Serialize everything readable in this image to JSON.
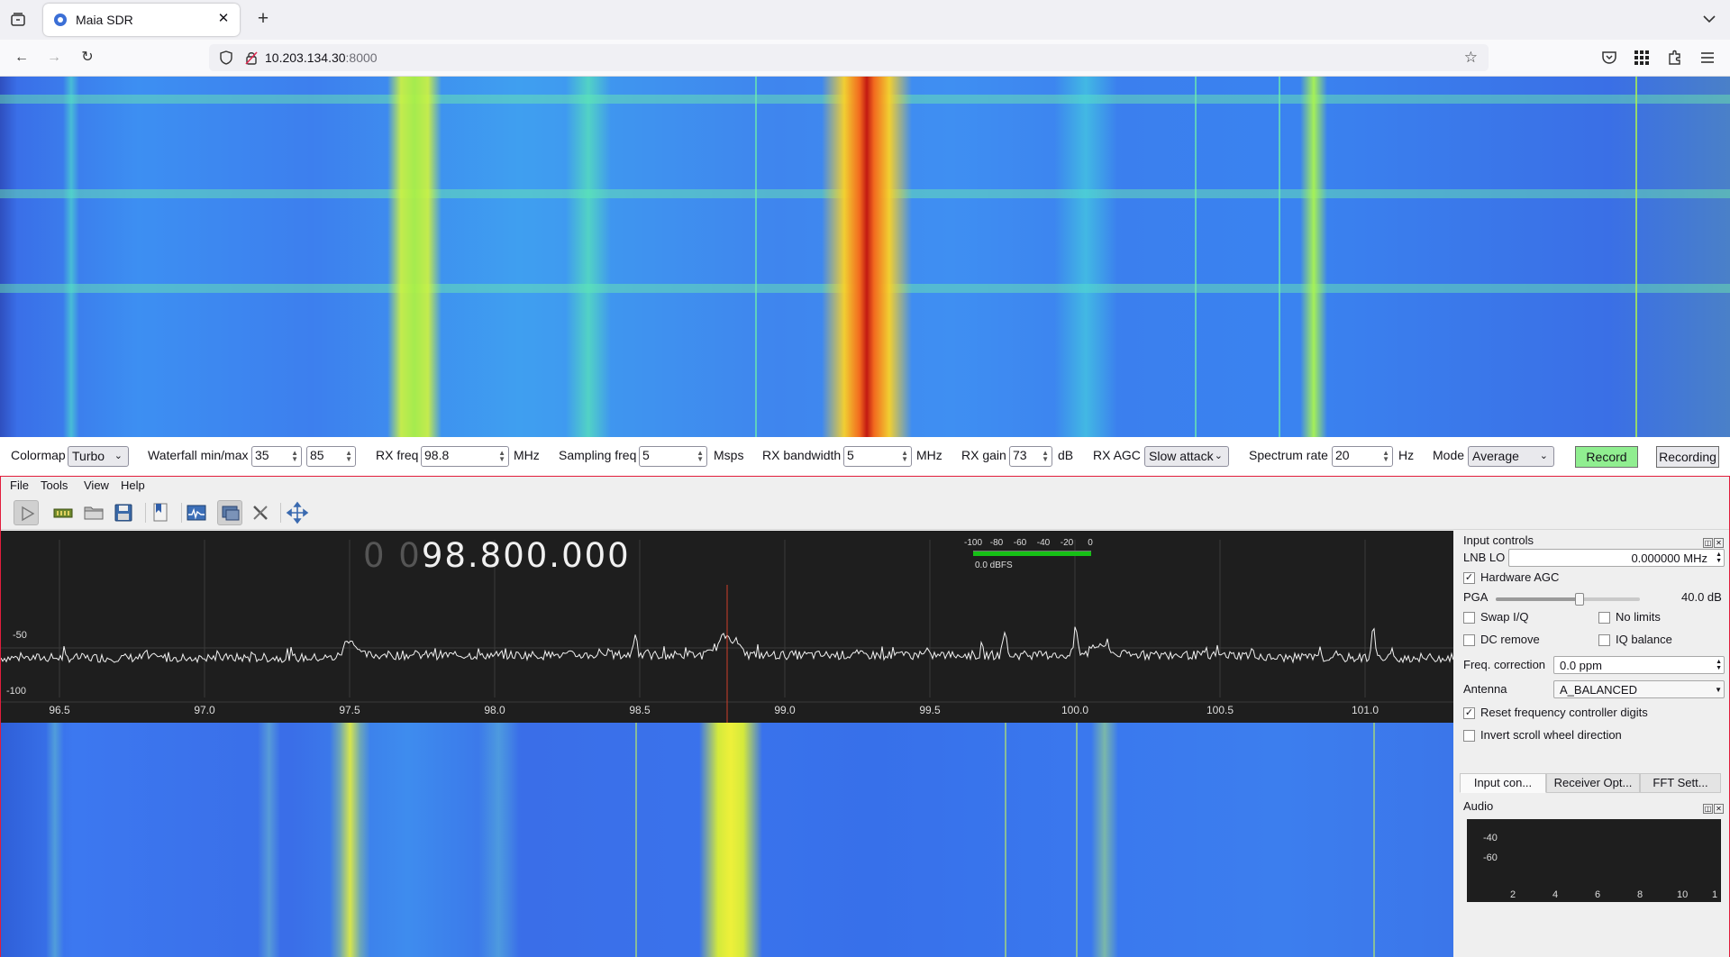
{
  "browser": {
    "tab_title": "Maia SDR",
    "url_host": "10.203.134.30",
    "url_port": ":8000"
  },
  "maia": {
    "freq_ticks": [
      "96.500",
      "97.000",
      "97.500",
      "98.000",
      "98.500",
      "99.000",
      "99.500",
      "100.000",
      "100.500",
      "101.000"
    ],
    "controls": {
      "colormap_label": "Colormap",
      "colormap_value": "Turbo",
      "waterfall_label": "Waterfall min/max",
      "waterfall_min": "35",
      "waterfall_max": "85",
      "rx_freq_label": "RX freq",
      "rx_freq_value": "98.8",
      "rx_freq_unit": "MHz",
      "sampling_label": "Sampling freq",
      "sampling_value": "5",
      "sampling_unit": "Msps",
      "bw_label": "RX bandwidth",
      "bw_value": "5",
      "bw_unit": "MHz",
      "gain_label": "RX gain",
      "gain_value": "73",
      "gain_unit": "dB",
      "agc_label": "RX AGC",
      "agc_value": "Slow attack",
      "rate_label": "Spectrum rate",
      "rate_value": "20",
      "rate_unit": "Hz",
      "mode_label": "Mode",
      "mode_value": "Average",
      "record_btn": "Record",
      "recording_btn": "Recording"
    }
  },
  "app": {
    "menu": [
      "File",
      "Tools",
      "View",
      "Help"
    ],
    "freq_dim": "0 0",
    "freq_main": "98.800.000",
    "meter_labels": [
      "-100",
      "-80",
      "-60",
      "-40",
      "-20",
      "0"
    ],
    "meter_value": "0.0 dBFS",
    "spec_y_labels": [
      "-50",
      "-100"
    ],
    "spec_x_labels": [
      "96.5",
      "97.0",
      "97.5",
      "98.0",
      "98.5",
      "99.0",
      "99.5",
      "100.0",
      "100.5",
      "101.0"
    ]
  },
  "dock": {
    "input_title": "Input controls",
    "lnb_label": "LNB LO",
    "lnb_value": "0.000000 MHz",
    "hw_agc": "Hardware AGC",
    "pga_label": "PGA",
    "pga_value": "40.0 dB",
    "pga_level": 0.58,
    "swap_iq": "Swap I/Q",
    "no_limits": "No limits",
    "dc_remove": "DC remove",
    "iq_balance": "IQ balance",
    "freq_corr_label": "Freq. correction",
    "freq_corr_value": "0.0 ppm",
    "antenna_label": "Antenna",
    "antenna_value": "A_BALANCED",
    "reset_digits": "Reset frequency controller digits",
    "invert_scroll": "Invert scroll wheel direction",
    "tabs": [
      "Input con...",
      "Receiver Opt...",
      "FFT Sett..."
    ],
    "audio_title": "Audio",
    "audio_y": [
      "-40",
      "-60"
    ],
    "audio_x": [
      "2",
      "4",
      "6",
      "8",
      "10",
      "1"
    ]
  },
  "colors": {
    "accent_red": "#e21d3c",
    "record_green": "#90ee90",
    "meter_green": "#16c016"
  }
}
